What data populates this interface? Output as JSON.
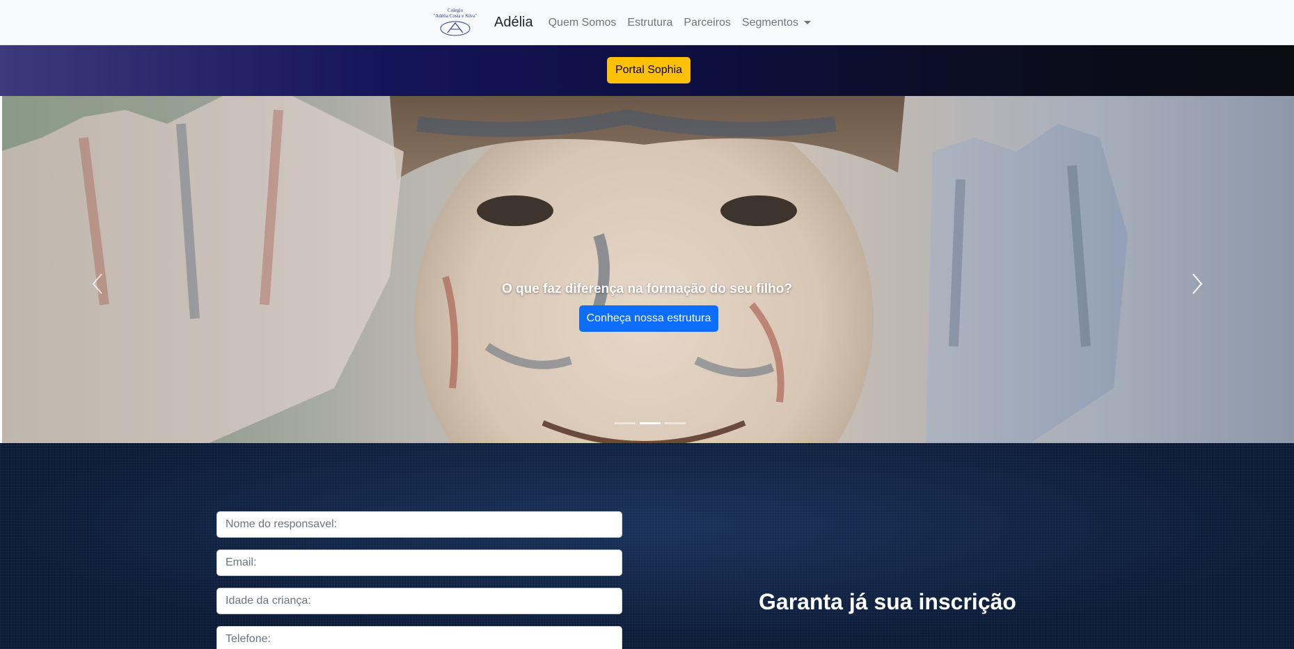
{
  "navbar": {
    "logo_text_1": "Colegio",
    "logo_text_2": "\"Adélia Costa e Silva\"",
    "brand": "Adélia",
    "links": [
      {
        "label": "Quem Somos"
      },
      {
        "label": "Estrutura"
      },
      {
        "label": "Parceiros"
      },
      {
        "label": "Segmentos"
      }
    ]
  },
  "portal": {
    "button_label": "Portal Sophia",
    "button_color": "#ffc107"
  },
  "hero": {
    "caption": "O que faz diferença na formação do seu filho?",
    "cta_label": "Conheça nossa estrutura",
    "cta_color": "#0d6efd",
    "prev_icon": "chevron-left-icon",
    "next_icon": "chevron-right-icon",
    "indicators": 3,
    "active_indicator": 2
  },
  "form": {
    "fields": [
      {
        "placeholder": "Nome do responsavel:"
      },
      {
        "placeholder": "Email:"
      },
      {
        "placeholder": "Idade da criança:"
      },
      {
        "placeholder": "Telefone:"
      }
    ],
    "title": "Garanta já sua inscrição"
  }
}
